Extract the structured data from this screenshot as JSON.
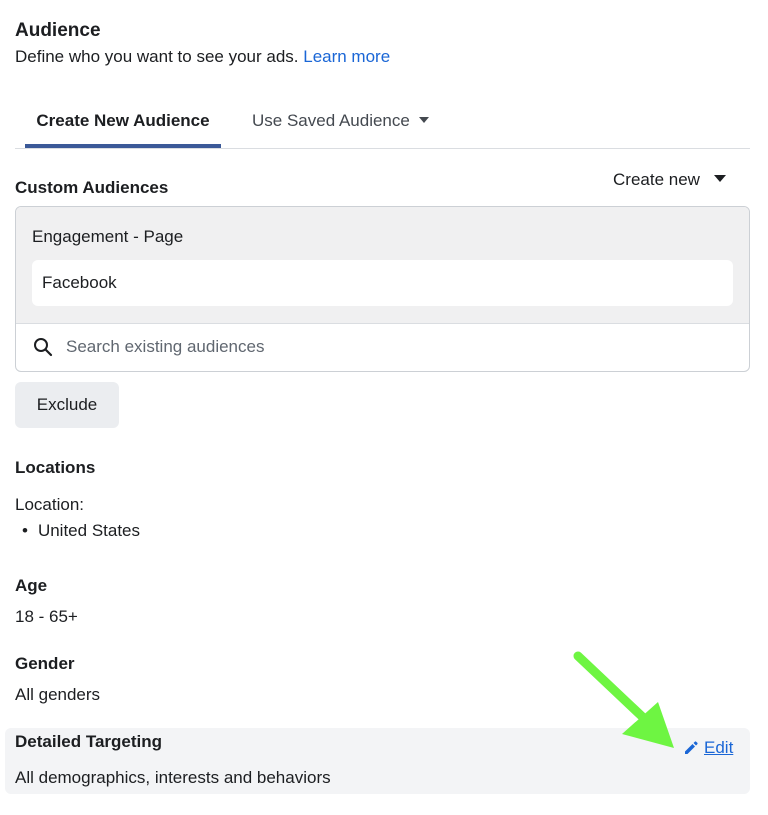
{
  "header": {
    "title": "Audience",
    "subtitle": "Define who you want to see your ads.",
    "learn_more": "Learn more"
  },
  "tabs": [
    {
      "label": "Create New Audience",
      "active": true
    },
    {
      "label": "Use Saved Audience",
      "active": false
    }
  ],
  "custom_audiences": {
    "label": "Custom Audiences",
    "create_new": "Create new",
    "group_label": "Engagement - Page",
    "selected": "Facebook",
    "search_placeholder": "Search existing audiences",
    "exclude_label": "Exclude"
  },
  "locations": {
    "label": "Locations",
    "sub_label": "Location:",
    "items": [
      "United States"
    ]
  },
  "age": {
    "label": "Age",
    "value": "18 - 65+"
  },
  "gender": {
    "label": "Gender",
    "value": "All genders"
  },
  "detailed_targeting": {
    "label": "Detailed Targeting",
    "value": "All demographics, interests and behaviors",
    "edit_label": "Edit"
  },
  "colors": {
    "link": "#1a66d6",
    "tab_underline": "#3b5998",
    "arrow": "#6ef542"
  },
  "icons": [
    "caret-down-icon",
    "search-icon",
    "pencil-icon",
    "arrow-annotation-icon"
  ]
}
